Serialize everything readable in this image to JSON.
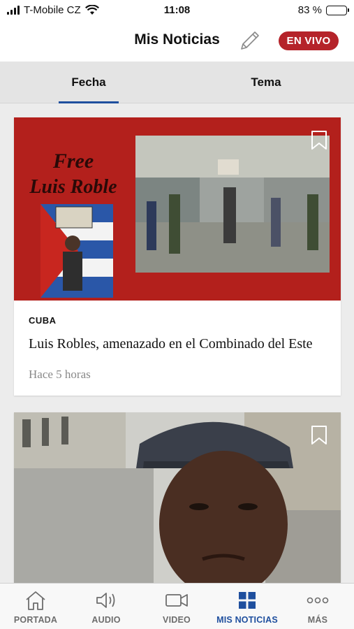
{
  "status_bar": {
    "carrier": "T-Mobile CZ",
    "time": "11:08",
    "battery_percent": "83 %",
    "battery_level": 0.83
  },
  "header": {
    "title": "Mis Noticias",
    "edit_icon": "pencil-icon",
    "live_label": "EN VIVO",
    "live_color": "#b5232a"
  },
  "tabs": [
    {
      "label": "Fecha",
      "active": true
    },
    {
      "label": "Tema",
      "active": false
    }
  ],
  "articles": [
    {
      "category": "CUBA",
      "headline": "Luis Robles, amenazado en el Combinado del Este",
      "time": "Hace 5 horas",
      "image_text": "Free Luis Roble",
      "bookmark_icon": "bookmark-icon"
    },
    {
      "bookmark_icon": "bookmark-icon"
    }
  ],
  "bottom_nav": [
    {
      "label": "PORTADA",
      "icon": "home-icon",
      "active": false
    },
    {
      "label": "AUDIO",
      "icon": "speaker-icon",
      "active": false
    },
    {
      "label": "VIDEO",
      "icon": "video-camera-icon",
      "active": false
    },
    {
      "label": "MIS NOTICIAS",
      "icon": "grid-icon",
      "active": true
    },
    {
      "label": "MÁS",
      "icon": "more-dots-icon",
      "active": false
    }
  ],
  "colors": {
    "accent": "#1f4f9e",
    "live_red": "#b5232a",
    "inactive_nav": "#6d6d6d"
  }
}
